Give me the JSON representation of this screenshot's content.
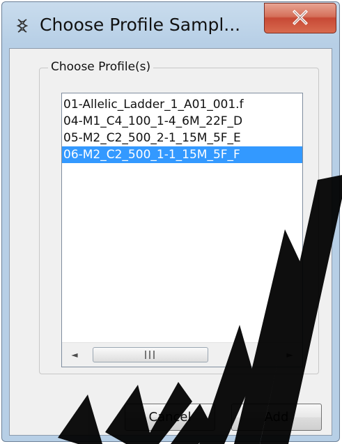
{
  "window": {
    "title": "Choose Profile Sampl..."
  },
  "group": {
    "legend": "Choose Profile(s)"
  },
  "profiles": {
    "items": [
      "01-Allelic_Ladder_1_A01_001.f",
      "04-M1_C4_100_1-4_6M_22F_D",
      "05-M2_C2_500_2-1_15M_5F_E",
      "06-M2_C2_500_1-1_15M_5F_F"
    ],
    "selected_index": 3
  },
  "scrollbar": {
    "left_arrow": "◄",
    "right_arrow": "►"
  },
  "buttons": {
    "cancel": "Cancel",
    "add": "Add"
  },
  "colors": {
    "selection": "#3399ff",
    "close_button": "#c74935",
    "watermark": "#000000"
  }
}
